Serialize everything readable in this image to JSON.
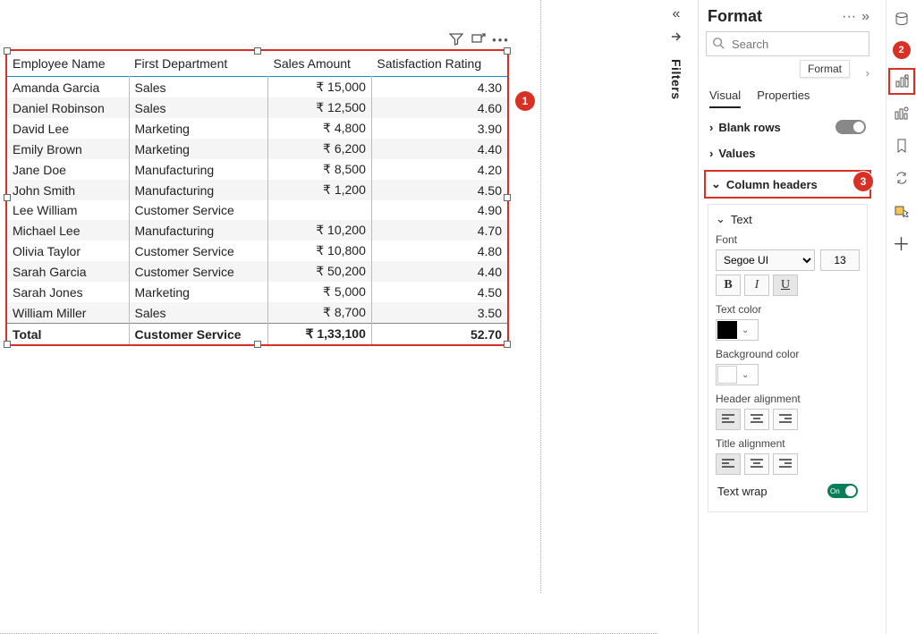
{
  "chart_data": {
    "type": "table",
    "columns": [
      "Employee Name",
      "First Department",
      "Sales Amount",
      "Satisfaction Rating"
    ],
    "rows": [
      [
        "Amanda Garcia",
        "Sales",
        "₹ 15,000",
        "4.30"
      ],
      [
        "Daniel Robinson",
        "Sales",
        "₹ 12,500",
        "4.60"
      ],
      [
        "David Lee",
        "Marketing",
        "₹ 4,800",
        "3.90"
      ],
      [
        "Emily Brown",
        "Marketing",
        "₹ 6,200",
        "4.40"
      ],
      [
        "Jane Doe",
        "Manufacturing",
        "₹ 8,500",
        "4.20"
      ],
      [
        "John Smith",
        "Manufacturing",
        "₹ 1,200",
        "4.50"
      ],
      [
        "Lee William",
        "Customer Service",
        "",
        "4.90"
      ],
      [
        "Michael Lee",
        "Manufacturing",
        "₹ 10,200",
        "4.70"
      ],
      [
        "Olivia Taylor",
        "Customer Service",
        "₹ 10,800",
        "4.80"
      ],
      [
        "Sarah Garcia",
        "Customer Service",
        "₹ 50,200",
        "4.40"
      ],
      [
        "Sarah Jones",
        "Marketing",
        "₹ 5,000",
        "4.50"
      ],
      [
        "William Miller",
        "Sales",
        "₹ 8,700",
        "3.50"
      ]
    ],
    "totals": [
      "Total",
      "Customer Service",
      "₹ 1,33,100",
      "52.70"
    ]
  },
  "table": {
    "headers": {
      "c0": "Employee Name",
      "c1": "First Department",
      "c2": "Sales Amount",
      "c3": "Satisfaction Rating"
    },
    "rows": [
      {
        "c0": "Amanda Garcia",
        "c1": "Sales",
        "c2": "₹ 15,000",
        "c3": "4.30"
      },
      {
        "c0": "Daniel Robinson",
        "c1": "Sales",
        "c2": "₹ 12,500",
        "c3": "4.60"
      },
      {
        "c0": "David Lee",
        "c1": "Marketing",
        "c2": "₹ 4,800",
        "c3": "3.90"
      },
      {
        "c0": "Emily Brown",
        "c1": "Marketing",
        "c2": "₹ 6,200",
        "c3": "4.40"
      },
      {
        "c0": "Jane Doe",
        "c1": "Manufacturing",
        "c2": "₹ 8,500",
        "c3": "4.20"
      },
      {
        "c0": "John Smith",
        "c1": "Manufacturing",
        "c2": "₹ 1,200",
        "c3": "4.50"
      },
      {
        "c0": "Lee William",
        "c1": "Customer Service",
        "c2": "",
        "c3": "4.90"
      },
      {
        "c0": "Michael Lee",
        "c1": "Manufacturing",
        "c2": "₹ 10,200",
        "c3": "4.70"
      },
      {
        "c0": "Olivia Taylor",
        "c1": "Customer Service",
        "c2": "₹ 10,800",
        "c3": "4.80"
      },
      {
        "c0": "Sarah Garcia",
        "c1": "Customer Service",
        "c2": "₹ 50,200",
        "c3": "4.40"
      },
      {
        "c0": "Sarah Jones",
        "c1": "Marketing",
        "c2": "₹ 5,000",
        "c3": "4.50"
      },
      {
        "c0": "William Miller",
        "c1": "Sales",
        "c2": "₹ 8,700",
        "c3": "3.50"
      }
    ],
    "total": {
      "c0": "Total",
      "c1": "Customer Service",
      "c2": "₹ 1,33,100",
      "c3": "52.70"
    }
  },
  "callouts": {
    "one": "1",
    "two": "2",
    "three": "3"
  },
  "filters": {
    "label": "Filters"
  },
  "format": {
    "title": "Format",
    "search_placeholder": "Search",
    "crumb": "Format",
    "tabs": {
      "visual": "Visual",
      "properties": "Properties"
    },
    "cards": {
      "blank_rows": {
        "label": "Blank rows",
        "toggle": "Off"
      },
      "values": {
        "label": "Values"
      },
      "column_headers": {
        "label": "Column headers"
      }
    },
    "text_card": {
      "title": "Text",
      "font_label": "Font",
      "font_value": "Segoe UI",
      "font_size": "13",
      "text_color_label": "Text color",
      "bg_color_label": "Background color",
      "header_align_label": "Header alignment",
      "title_align_label": "Title alignment",
      "text_wrap_label": "Text wrap",
      "text_wrap_toggle": "On"
    }
  }
}
